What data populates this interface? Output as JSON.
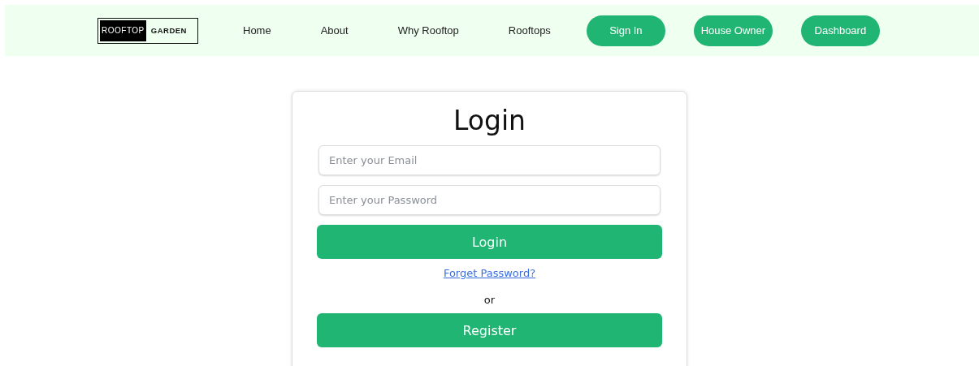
{
  "navbar": {
    "logo": {
      "dark_part": "ROOFTOP",
      "light_part": "GARDEN"
    },
    "links": [
      "Home",
      "About",
      "Why Rooftop",
      "Rooftops"
    ],
    "buttons": [
      "Sign In",
      "House Owner",
      "Dashboard"
    ]
  },
  "login_card": {
    "title": "Login",
    "fields": [
      {
        "placeholder": "Enter your Email"
      },
      {
        "placeholder": "Enter your Password"
      }
    ],
    "login_button": "Login",
    "forgot_link": "Forget Password?",
    "separator": "or",
    "register_button": "Register"
  }
}
